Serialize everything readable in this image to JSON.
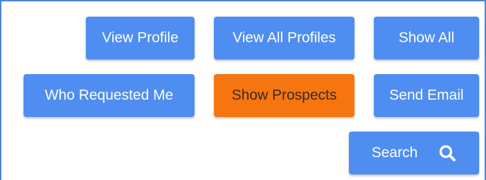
{
  "colors": {
    "primary": "#4f8ef0",
    "accent": "#f7750f",
    "frame": "#4a83d8"
  },
  "buttons": {
    "view_profile": "View Profile",
    "view_all_profiles": "View All Profiles",
    "show_all": "Show All",
    "who_requested_me": "Who Requested Me",
    "show_prospects": "Show Prospects",
    "send_email": "Send Email",
    "search": "Search"
  },
  "icons": {
    "search": "search-icon"
  }
}
